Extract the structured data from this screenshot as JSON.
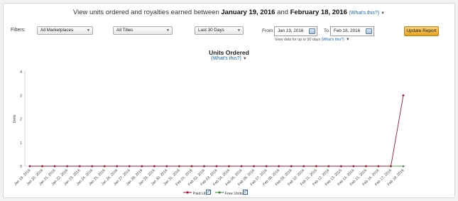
{
  "header": {
    "prefix": "View units ordered and royalties earned between",
    "start": "January 19, 2016",
    "and_text": "and",
    "end": "February 18, 2016",
    "help": "(What's this?)"
  },
  "filters": {
    "label": "Filters:",
    "marketplace": "All Marketplaces",
    "titles": "All Titles",
    "range": "Last 30 Days",
    "from_label": "From:",
    "from_value": "Jan 19, 2016",
    "to_label": "To:",
    "to_value": "Feb 18, 2016",
    "note": "View data for up to 90 days",
    "note_help": "(What's this?)",
    "update_label": "Update Report"
  },
  "chart_data": {
    "type": "line",
    "title": "Units Ordered",
    "subtitle": "(What's this?)",
    "ylabel": "Units",
    "ylim": [
      0,
      4
    ],
    "yticks": [
      0,
      1,
      2,
      3,
      4
    ],
    "categories": [
      "Jan 19, 2016",
      "Jan 20, 2016",
      "Jan 21, 2016",
      "Jan 22, 2016",
      "Jan 23, 2016",
      "Jan 24, 2016",
      "Jan 25, 2016",
      "Jan 26, 2016",
      "Jan 27, 2016",
      "Jan 28, 2016",
      "Jan 29, 2016",
      "Jan 30, 2016",
      "Jan 31, 2016",
      "Feb 01, 2016",
      "Feb 02, 2016",
      "Feb 03, 2016",
      "Feb 04, 2016",
      "Feb 05, 2016",
      "Feb 06, 2016",
      "Feb 07, 2016",
      "Feb 08, 2016",
      "Feb 09, 2016",
      "Feb 10, 2016",
      "Feb 11, 2016",
      "Feb 12, 2016",
      "Feb 13, 2016",
      "Feb 14, 2016",
      "Feb 15, 2016",
      "Feb 16, 2016",
      "Feb 17, 2016",
      "Feb 18, 2016"
    ],
    "series": [
      {
        "name": "Paid Units",
        "color": "#a3172f",
        "values": [
          0,
          0,
          0,
          0,
          0,
          0,
          0,
          0,
          0,
          0,
          0,
          0,
          0,
          0,
          0,
          0,
          0,
          0,
          0,
          0,
          0,
          0,
          0,
          0,
          0,
          0,
          0,
          0,
          0,
          0,
          3
        ]
      },
      {
        "name": "Free Units",
        "color": "#3f8a3a",
        "values": [
          0,
          0,
          0,
          0,
          0,
          0,
          0,
          0,
          0,
          0,
          0,
          0,
          0,
          0,
          0,
          0,
          0,
          0,
          0,
          0,
          0,
          0,
          0,
          0,
          0,
          0,
          0,
          0,
          0,
          0,
          0
        ]
      }
    ],
    "grid": false,
    "legend_position": "bottom-center"
  },
  "icons": {
    "dropdown": "chevron-down-icon",
    "calendar": "calendar-icon",
    "checkbox": "checkbox-checked-icon"
  }
}
